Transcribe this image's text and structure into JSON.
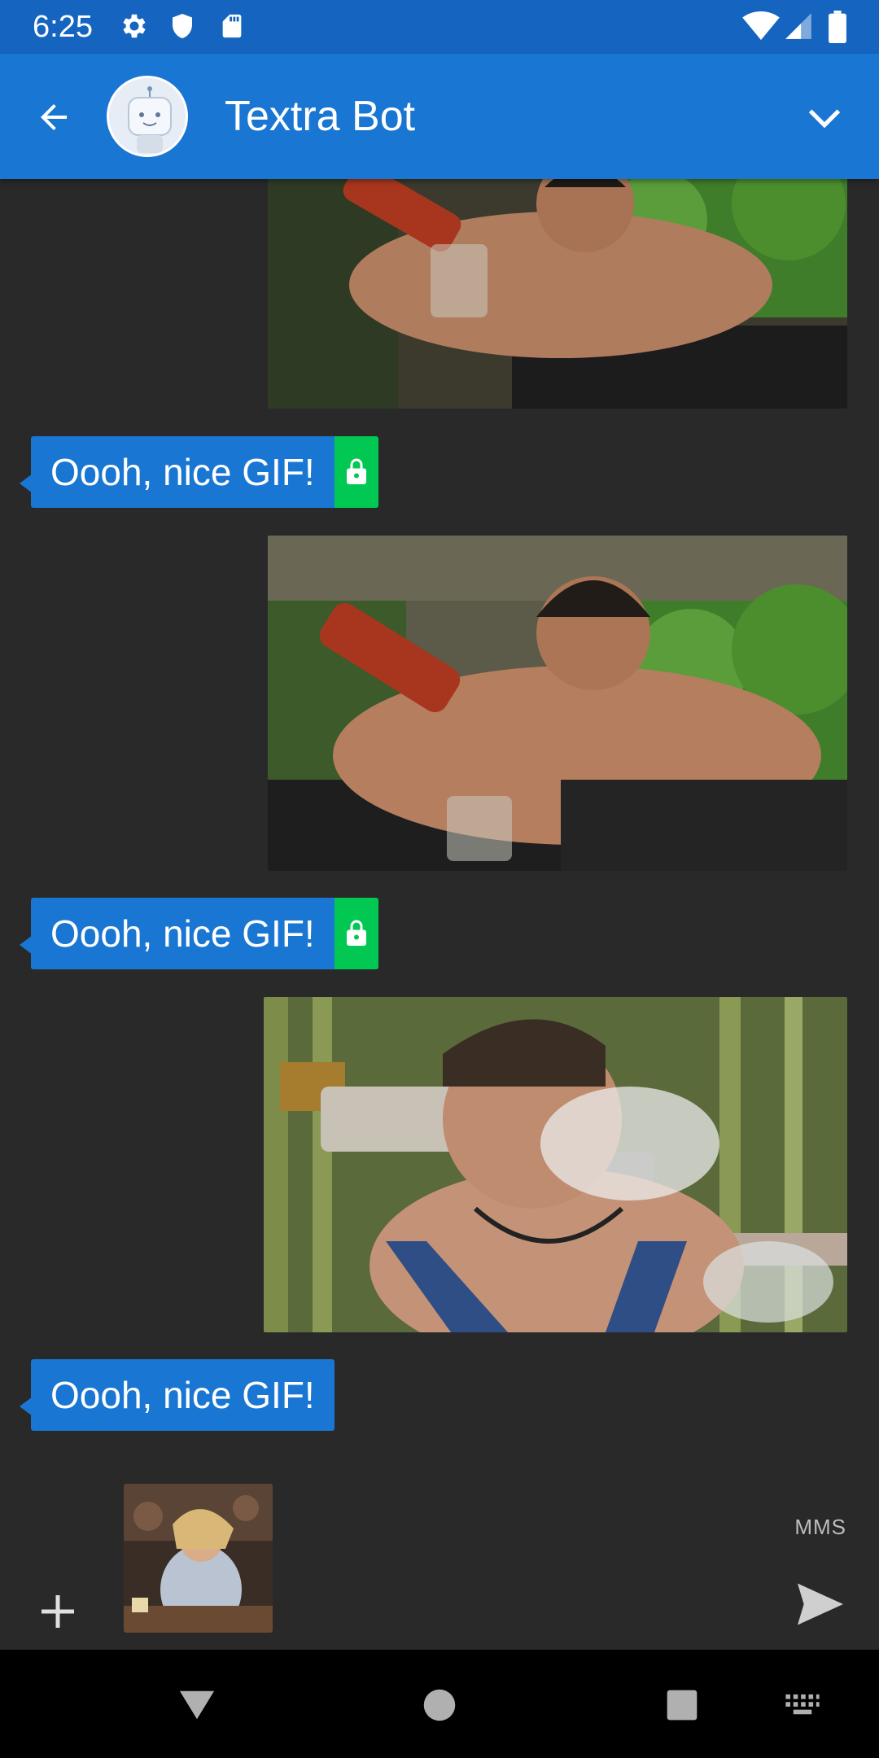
{
  "status_bar": {
    "time": "6:25",
    "icons": [
      "settings-icon",
      "shield-icon",
      "sd-card-icon",
      "wifi-icon",
      "signal-icon",
      "battery-icon"
    ]
  },
  "toolbar": {
    "title": "Textra Bot",
    "back_icon": "arrow-back-icon",
    "menu_icon": "chevron-down-icon"
  },
  "messages": [
    {
      "type": "gif",
      "direction": "outgoing",
      "content": "gif-pouring-drink"
    },
    {
      "type": "text",
      "direction": "incoming",
      "text": "Oooh, nice GIF!",
      "encrypted": true
    },
    {
      "type": "gif",
      "direction": "outgoing",
      "content": "gif-pouring-drink"
    },
    {
      "type": "text",
      "direction": "incoming",
      "text": "Oooh, nice GIF!",
      "encrypted": true
    },
    {
      "type": "gif",
      "direction": "outgoing",
      "content": "gif-blowing-smoke"
    },
    {
      "type": "text",
      "direction": "incoming",
      "text": "Oooh, nice GIF!",
      "encrypted": false
    }
  ],
  "compose": {
    "mode_label": "MMS",
    "attachment": "gif-thumbnail",
    "add_icon": "plus-icon",
    "send_icon": "send-icon"
  },
  "colors": {
    "status_bar": "#1565c0",
    "toolbar": "#1976d2",
    "bubble": "#1976d2",
    "lock": "#00c853",
    "background": "#292929"
  }
}
